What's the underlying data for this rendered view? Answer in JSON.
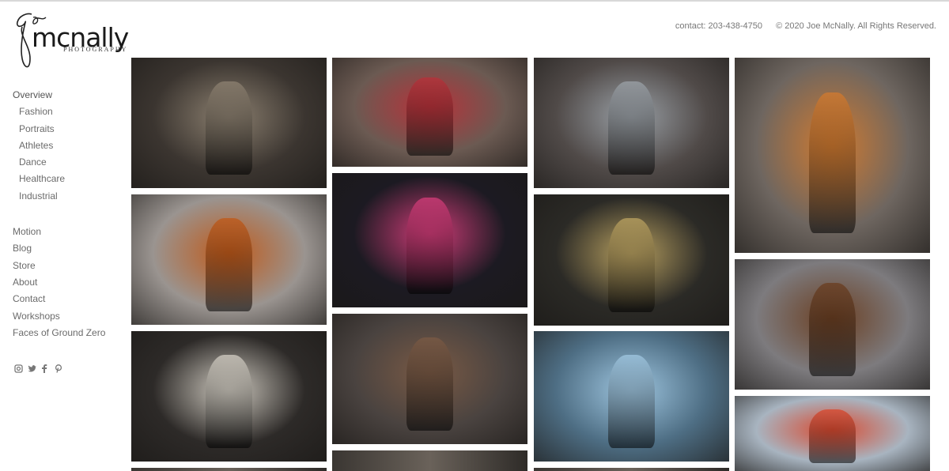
{
  "brand": {
    "logo_word": "mcnally",
    "logo_sub": "PHOTOGRAPHY",
    "logo_script": "Joe"
  },
  "header": {
    "contact": "contact: 203-438-4750",
    "copyright": "© 2020  Joe McNally. All Rights Reserved."
  },
  "nav": {
    "overview": "Overview",
    "categories": [
      "Fashion",
      "Portraits",
      "Athletes",
      "Dance",
      "Healthcare",
      "Industrial"
    ],
    "links": [
      "Motion",
      "Blog",
      "Store",
      "About",
      "Contact",
      "Workshops",
      "Faces of Ground Zero"
    ]
  },
  "social": [
    "instagram-icon",
    "twitter-icon",
    "facebook-icon",
    "pinterest-icon"
  ],
  "gallery": {
    "photos": [
      {
        "name": "photo-dark-room-woman",
        "bg": "#3b3530",
        "accent": "#8c8070"
      },
      {
        "name": "photo-worker-rooftop",
        "bg": "#9a9490",
        "accent": "#c05a1a"
      },
      {
        "name": "photo-breakdancer-warehouse",
        "bg": "#2d2a28",
        "accent": "#cfcac0"
      },
      {
        "name": "photo-woman-beanie",
        "bg": "#6b5a52",
        "accent": "#b7323a"
      },
      {
        "name": "photo-taxi-city-night",
        "bg": "#1c1a22",
        "accent": "#d03c78"
      },
      {
        "name": "photo-athlete-brick-wall",
        "bg": "#4a4340",
        "accent": "#7a5a45"
      },
      {
        "name": "photo-man-window",
        "bg": "#504a48",
        "accent": "#9aa0a6"
      },
      {
        "name": "photo-woman-gold-dress",
        "bg": "#2b2a26",
        "accent": "#b8a060"
      },
      {
        "name": "photo-surgeons",
        "bg": "#4e6e84",
        "accent": "#9fc6e0"
      },
      {
        "name": "photo-showgirl-desert",
        "bg": "#6e6660",
        "accent": "#d07a30"
      },
      {
        "name": "photo-cowboy-storm",
        "bg": "#7d7b7e",
        "accent": "#6b3f22"
      },
      {
        "name": "photo-helicopter-rescue",
        "bg": "#a8b4c0",
        "accent": "#d94a30"
      }
    ]
  }
}
